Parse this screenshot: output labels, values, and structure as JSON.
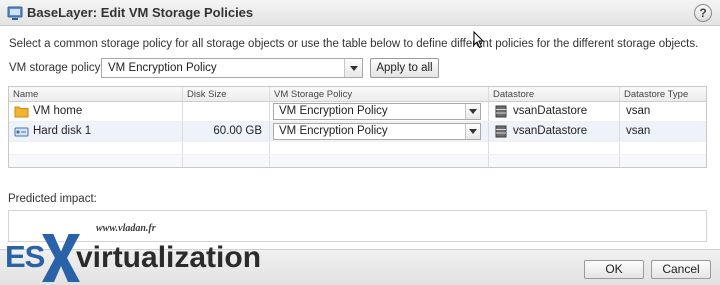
{
  "window": {
    "title": "BaseLayer: Edit VM Storage Policies",
    "help": "?"
  },
  "instructions": "Select a common storage policy for all storage objects or use the table below to define different policies for the different storage objects.",
  "storage_policy": {
    "label": "VM storage policy:",
    "value": "VM Encryption Policy",
    "apply_label": "Apply to all"
  },
  "table": {
    "columns": [
      "Name",
      "Disk Size",
      "VM Storage Policy",
      "Datastore",
      "Datastore Type"
    ],
    "rows": [
      {
        "name": "VM home",
        "icon": "folder-icon",
        "disk_size": "",
        "policy": "VM Encryption Policy",
        "datastore": "vsanDatastore",
        "datastore_type": "vsan"
      },
      {
        "name": "Hard disk 1",
        "icon": "hard-disk-icon",
        "disk_size": "60.00 GB",
        "policy": "VM Encryption Policy",
        "datastore": "vsanDatastore",
        "datastore_type": "vsan"
      }
    ]
  },
  "impact": {
    "label": "Predicted impact:"
  },
  "footer": {
    "ok_label": "OK",
    "cancel_label": "Cancel"
  },
  "watermark": {
    "url": "www.vladan.fr",
    "es": "ES",
    "virt": "virtualization"
  },
  "colors": {
    "accent": "#2a62a8",
    "selected_row": "#eef3fa",
    "folder": "#f2b233"
  }
}
